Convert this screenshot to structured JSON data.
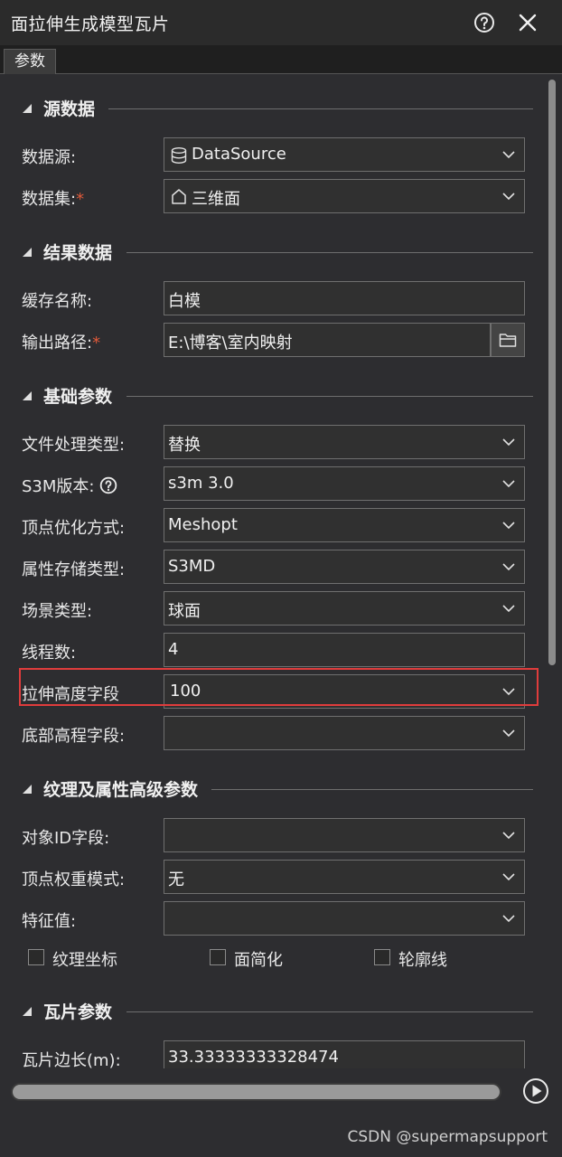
{
  "window": {
    "title": "面拉伸生成模型瓦片"
  },
  "tabs": [
    {
      "label": "参数"
    }
  ],
  "sections": {
    "source": {
      "title": "源数据"
    },
    "result": {
      "title": "结果数据"
    },
    "basic": {
      "title": "基础参数"
    },
    "texture": {
      "title": "纹理及属性高级参数"
    },
    "tile": {
      "title": "瓦片参数"
    }
  },
  "source": {
    "datasource_label": "数据源:",
    "datasource_value": "DataSource",
    "dataset_label": "数据集:",
    "dataset_value": "三维面",
    "required_mark": "*"
  },
  "result": {
    "cache_name_label": "缓存名称:",
    "cache_name_value": "白模",
    "output_path_label": "输出路径:",
    "output_path_value": "E:\\博客\\室内映射"
  },
  "basic": {
    "file_type_label": "文件处理类型:",
    "file_type_value": "替换",
    "s3m_version_label": "S3M版本:",
    "s3m_version_value": "s3m 3.0",
    "vertex_opt_label": "顶点优化方式:",
    "vertex_opt_value": "Meshopt",
    "attr_storage_label": "属性存储类型:",
    "attr_storage_value": "S3MD",
    "scene_type_label": "场景类型:",
    "scene_type_value": "球面",
    "threads_label": "线程数:",
    "threads_value": "4",
    "extrude_height_label": "拉伸高度字段",
    "extrude_height_value": "100",
    "bottom_elev_label": "底部高程字段:",
    "bottom_elev_value": ""
  },
  "texture": {
    "object_id_label": "对象ID字段:",
    "object_id_value": "",
    "vertex_weight_label": "顶点权重模式:",
    "vertex_weight_value": "无",
    "feature_value_label": "特征值:",
    "feature_value_value": "",
    "checkboxes": [
      {
        "label": "纹理坐标",
        "checked": false
      },
      {
        "label": "面简化",
        "checked": false
      },
      {
        "label": "轮廓线",
        "checked": false
      }
    ]
  },
  "tile": {
    "edge_length_label": "瓦片边长(m):",
    "edge_length_value": "33.33333333328474"
  },
  "footer": {
    "watermark": "CSDN @supermapsupport"
  },
  "colors": {
    "highlight": "#e03c3c",
    "required": "#e05a3a",
    "background": "#2d2d30"
  }
}
